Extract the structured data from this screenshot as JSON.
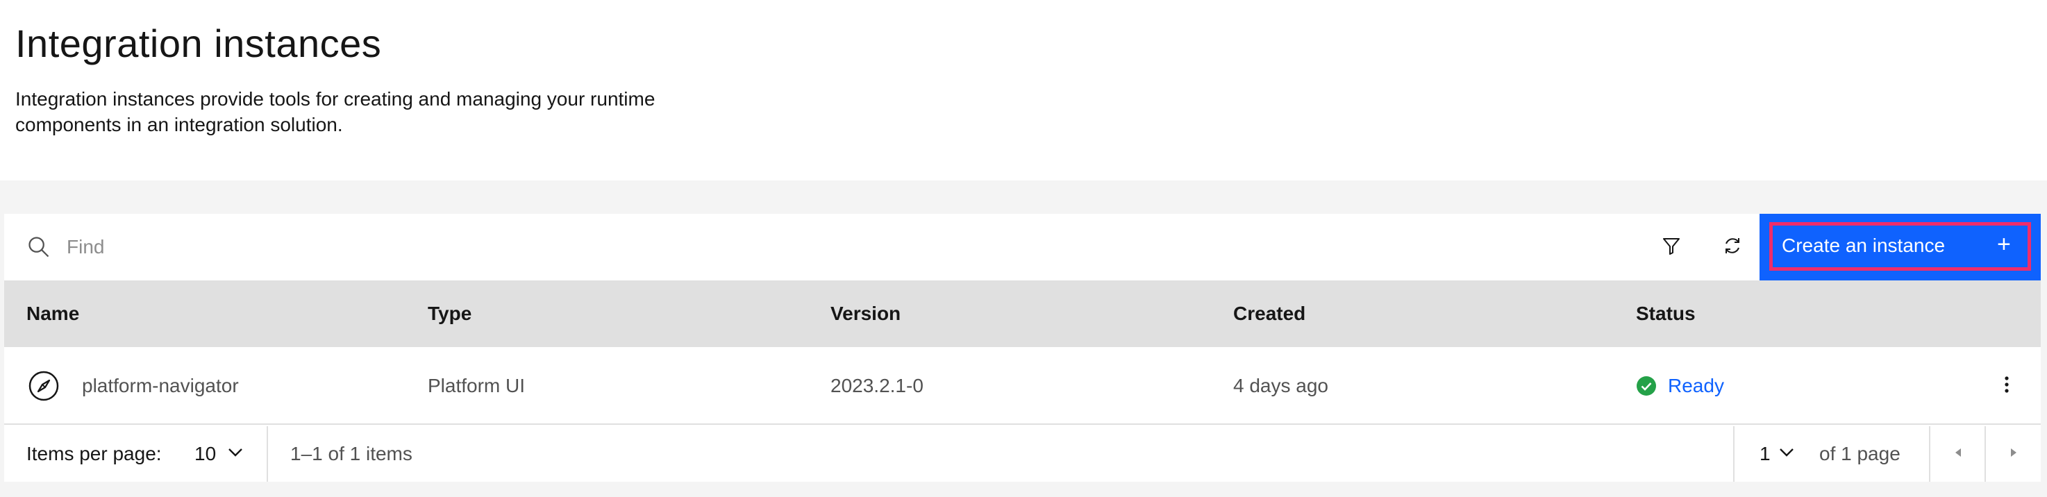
{
  "header": {
    "title": "Integration instances",
    "description": "Integration instances provide tools for creating and managing your runtime components in an integration solution."
  },
  "toolbar": {
    "search_placeholder": "Find",
    "create_label": "Create an instance",
    "create_icon": "+"
  },
  "table": {
    "columns": [
      "Name",
      "Type",
      "Version",
      "Created",
      "Status"
    ],
    "rows": [
      {
        "icon": "compass-icon",
        "name": "platform-navigator",
        "type": "Platform UI",
        "version": "2023.2.1-0",
        "created": "4 days ago",
        "status": "Ready",
        "status_icon": "checkmark-filled-icon"
      }
    ]
  },
  "pagination": {
    "items_per_page_label": "Items per page:",
    "items_per_page_value": "10",
    "range_text": "1–1 of 1 items",
    "page_value": "1",
    "page_total_text": "of 1 page"
  },
  "colors": {
    "primary": "#0f62fe",
    "focus_outline": "#ef2d6b",
    "success": "#24a148",
    "header_bg": "#e0e0e0",
    "page_bg": "#f4f4f4"
  }
}
